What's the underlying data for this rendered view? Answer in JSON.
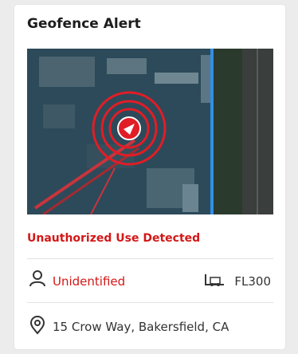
{
  "card": {
    "title": "Geofence Alert",
    "alert_text": "Unauthorized Use Detected",
    "operator": "Unidentified",
    "vehicle_id": "FL300",
    "address": "15 Crow Way, Bakersfield, CA"
  },
  "icons": {
    "operator": "user-icon",
    "vehicle": "forklift-icon",
    "location": "location-pin-icon",
    "map_marker": "navigation-arrow-icon"
  },
  "colors": {
    "alert": "#d41717",
    "geofence_line": "#2f8fe8",
    "text": "#333333"
  }
}
